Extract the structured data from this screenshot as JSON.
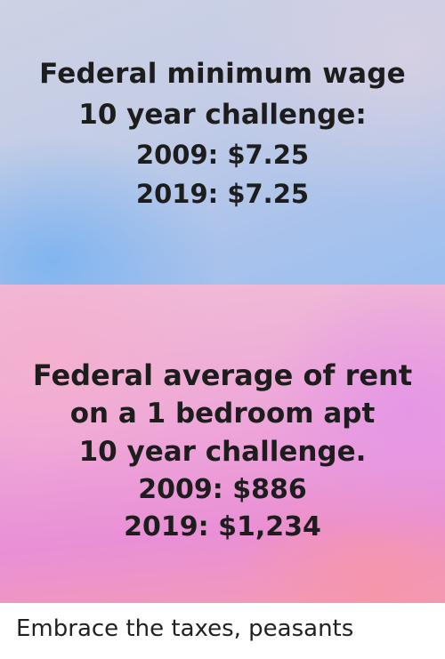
{
  "meme": {
    "top_panel": {
      "lines": [
        "Federal minimum wage",
        "10 year challenge:",
        "2009: $7.25",
        "2019: $7.25"
      ]
    },
    "bottom_panel": {
      "lines": [
        "Federal average of rent",
        "on a 1 bedroom apt",
        "10 year challenge.",
        "2009: $886",
        "2019: $1,234"
      ]
    }
  },
  "caption": "Embrace the taxes, peasants"
}
